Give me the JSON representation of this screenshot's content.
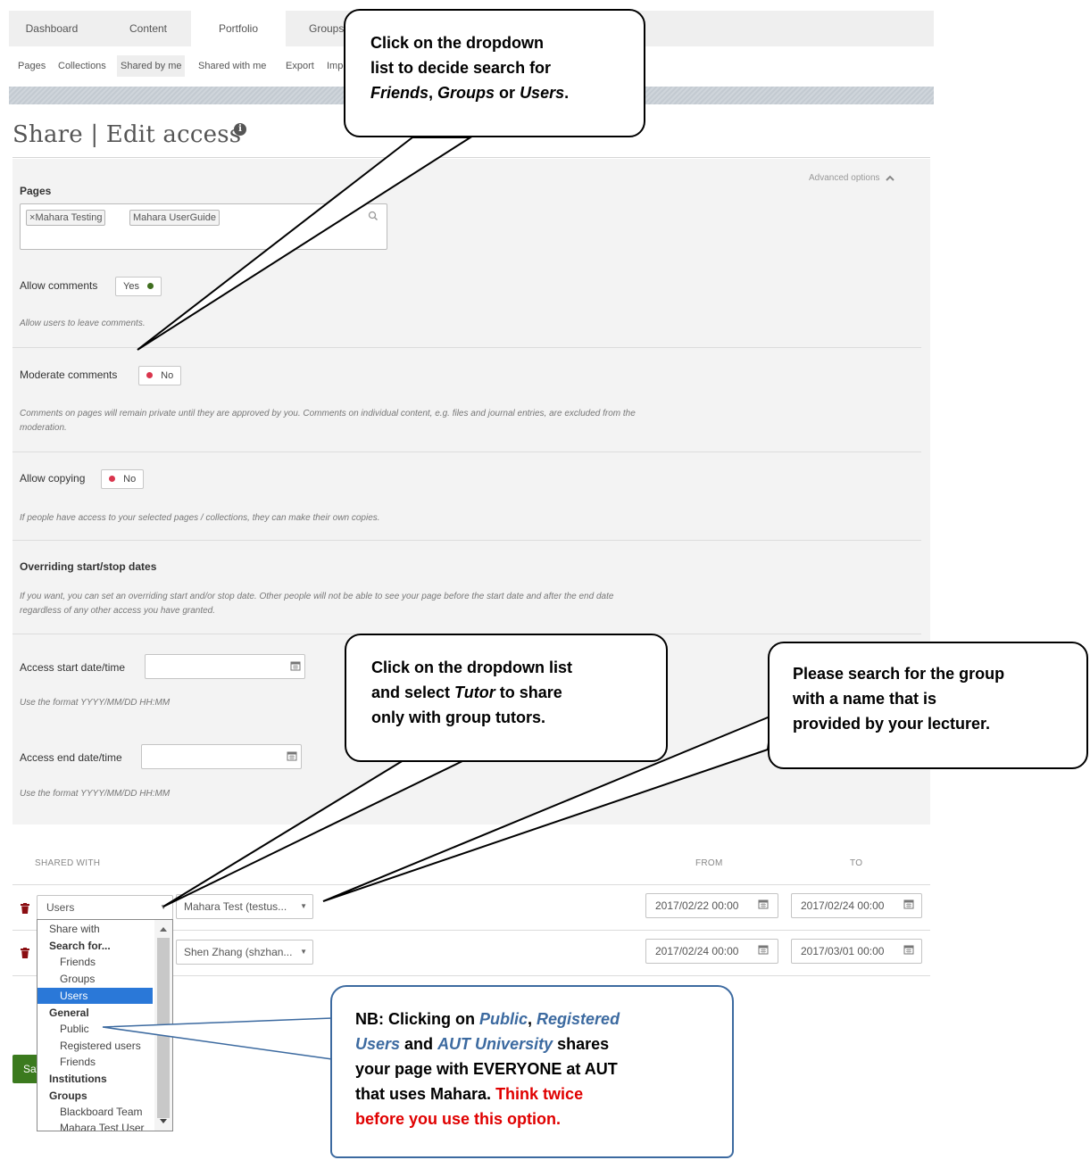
{
  "top_nav": {
    "tabs": [
      {
        "label": "Dashboard"
      },
      {
        "label": "Content"
      },
      {
        "label": "Portfolio"
      },
      {
        "label": "Groups"
      }
    ],
    "active_index": 2
  },
  "sub_nav": {
    "items": [
      {
        "label": "Pages"
      },
      {
        "label": "Collections"
      },
      {
        "label": "Shared by me"
      },
      {
        "label": "Shared with me"
      },
      {
        "label": "Export"
      },
      {
        "label": "Import"
      }
    ],
    "active_index": 2
  },
  "page": {
    "title": "Share | Edit access",
    "info_icon": "info-icon"
  },
  "form": {
    "advanced_options": "Advanced options",
    "pages_label": "Pages",
    "selected_pages": [
      "Mahara Testing",
      "Mahara UserGuide"
    ],
    "chip_remove": "×",
    "allow_comments": {
      "label": "Allow comments",
      "value": "Yes",
      "description": "Allow users to leave comments."
    },
    "moderate_comments": {
      "label": "Moderate comments",
      "value": "No",
      "description_line1": "Comments on pages will remain private until they are approved by you. Comments on individual content, e.g. files and journal entries, are excluded from the",
      "description_line2": "moderation."
    },
    "allow_copying": {
      "label": "Allow copying",
      "value": "No",
      "description": "If people have access to your selected pages / collections, they can make their own copies."
    },
    "overriding": {
      "heading": "Overriding start/stop dates",
      "description_line1": "If you want, you can set an overriding start and/or stop date. Other people will not be able to see your page before the start date and after the end date",
      "description_line2": "regardless of any other access you have granted."
    },
    "access_start": {
      "label": "Access start date/time",
      "value": "",
      "hint": "Use the format YYYY/MM/DD HH:MM"
    },
    "access_end": {
      "label": "Access end date/time",
      "value": "",
      "hint": "Use the format YYYY/MM/DD HH:MM"
    }
  },
  "shared_table": {
    "headers": {
      "shared_with": "SHARED WITH",
      "from": "FROM",
      "to": "TO"
    },
    "rows": [
      {
        "type": "Users",
        "name": "Mahara Test (testus...",
        "from": "2017/02/22 00:00",
        "to": "2017/02/24 00:00"
      },
      {
        "type": "",
        "name": "Shen Zhang (shzhan...",
        "from": "2017/02/24 00:00",
        "to": "2017/03/01 00:00"
      }
    ]
  },
  "dropdown": {
    "items": [
      {
        "label": "Share with",
        "kind": "plain"
      },
      {
        "label": "Search for...",
        "kind": "group"
      },
      {
        "label": "Friends",
        "kind": "opt"
      },
      {
        "label": "Groups",
        "kind": "opt"
      },
      {
        "label": "Users",
        "kind": "opt",
        "selected": true
      },
      {
        "label": "General",
        "kind": "group"
      },
      {
        "label": "Public",
        "kind": "opt"
      },
      {
        "label": "Registered users",
        "kind": "opt"
      },
      {
        "label": "Friends",
        "kind": "opt"
      },
      {
        "label": "Institutions",
        "kind": "group"
      },
      {
        "label": "Groups",
        "kind": "group"
      },
      {
        "label": "Blackboard Team",
        "kind": "opt"
      },
      {
        "label": "Mahara Test User",
        "kind": "opt"
      }
    ]
  },
  "save_button": {
    "label": "Save"
  },
  "callouts": {
    "top": {
      "line1": "Click on the dropdown",
      "line2": "list to decide search for",
      "line3_a": "Friends",
      "line3_sep1": ", ",
      "line3_b": "Groups",
      "line3_sep2": " or ",
      "line3_c": "Users",
      "line3_end": "."
    },
    "tutor": {
      "line1": "Click on the dropdown list",
      "line2_a": "and select ",
      "line2_b": "Tutor",
      "line2_c": " to share",
      "line3": "only with group tutors."
    },
    "group": {
      "line1": "Please search for the group",
      "line2": "with a name that is",
      "line3": "provided by your lecturer."
    },
    "nb": {
      "line1_a": "NB: Clicking on ",
      "line1_b": "Public",
      "line1_c": ", ",
      "line1_d": "Registered",
      "line2_a": "Users",
      "line2_b": " and ",
      "line2_c": "AUT University",
      "line2_d": " shares",
      "line3": "your page with EVERYONE at AUT",
      "line4_a": "that uses Mahara.  ",
      "line4_b": "Think twice",
      "line5": "before you use this option."
    }
  },
  "colors": {
    "accent_green": "#3b7a1e",
    "selected_blue": "#2a78d8",
    "warning_red": "#e00000",
    "callout_blue": "#3c6aa0"
  }
}
